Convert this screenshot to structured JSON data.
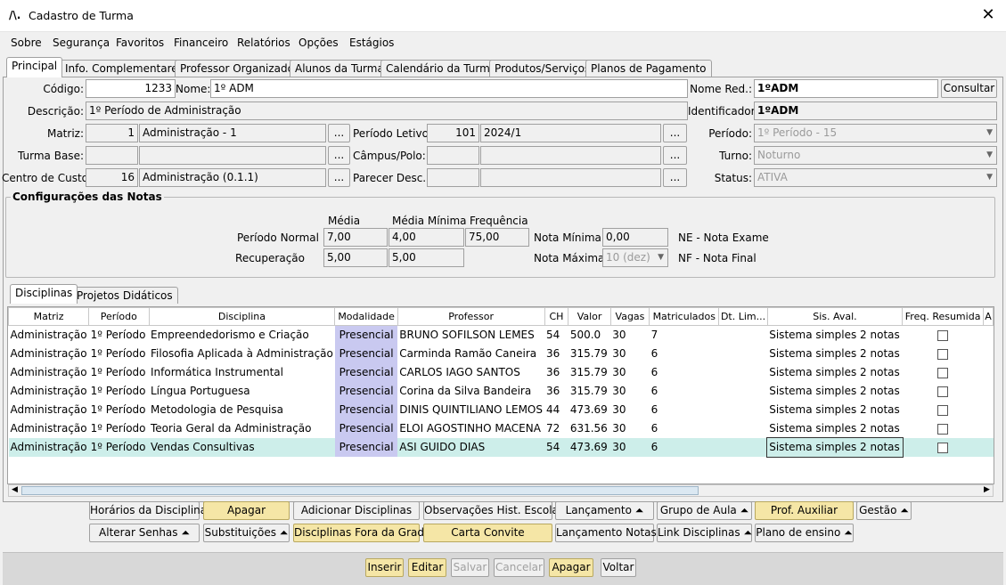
{
  "window": {
    "title": "Cadastro de Turma"
  },
  "menu": [
    "Sobre",
    "Segurança",
    "Favoritos",
    "Financeiro",
    "Relatórios",
    "Opções",
    "Estágios"
  ],
  "tabs": [
    "Principal",
    "Info. Complementares",
    "Professor Organizador",
    "Alunos da Turma",
    "Calendário da Turma",
    "Produtos/Serviços",
    "Planos de Pagamento"
  ],
  "form": {
    "codigo_label": "Código:",
    "codigo": "1233",
    "nome_label": "Nome:",
    "nome": "1º ADM",
    "nome_red_label": "Nome Red.:",
    "nome_red": "1ºADM",
    "consultar": "Consultar",
    "descricao_label": "Descrição:",
    "descricao": "1º Período de Administração",
    "identificador_label": "Identificador:",
    "identificador": "1ºADM",
    "matriz_label": "Matriz:",
    "matriz_cod": "1",
    "matriz": "Administração - 1",
    "periodo_letivo_label": "Período Letivo:",
    "periodo_letivo_cod": "101",
    "periodo_letivo": "2024/1",
    "periodo_label": "Período:",
    "periodo": "1º Período - 15",
    "turma_base_label": "Turma Base:",
    "campus_label": "Câmpus/Polo:",
    "turno_label": "Turno:",
    "turno": "Noturno",
    "centro_custo_label": "Centro de Custo:",
    "centro_custo_cod": "16",
    "centro_custo": "Administração (0.1.1)",
    "parecer_label": "Parecer Desc.:",
    "status_label": "Status:",
    "status": "ATIVA",
    "ellipsis": "..."
  },
  "notas": {
    "title": "Configurações das Notas",
    "h_media": "Média",
    "h_media_min": "Média Mínima",
    "h_freq": "Frequência",
    "periodo_normal": "Período Normal",
    "pn_media": "7,00",
    "pn_media_min": "4,00",
    "pn_freq": "75,00",
    "recuperacao": "Recuperação",
    "rec_media": "5,00",
    "rec_media_min": "5,00",
    "nota_minima_label": "Nota Mínima",
    "nota_minima": "0,00",
    "nota_maxima_label": "Nota Máxima",
    "nota_maxima": "10 (dez)",
    "ne": "NE - Nota Exame",
    "nf": "NF - Nota Final"
  },
  "subtabs": [
    "Disciplinas",
    "Projetos Didáticos"
  ],
  "grid": {
    "columns": [
      "Matriz",
      "Período",
      "Disciplina",
      "Modalidade",
      "Professor",
      "CH",
      "Valor",
      "Vagas",
      "Matriculados",
      "Dt. Lim...",
      "Sis. Aval.",
      "Freq. Resumida",
      "A"
    ],
    "rows": [
      [
        "Administração",
        "1º Período",
        "Empreendedorismo e Criação",
        "Presencial",
        "BRUNO SOFILSON LEMES",
        "54",
        "500.0",
        "30",
        "7",
        "",
        "Sistema simples 2 notas"
      ],
      [
        "Administração",
        "1º Período",
        "Filosofia Aplicada à Administração",
        "Presencial",
        "Carminda Ramão Caneira",
        "36",
        "315.79",
        "30",
        "6",
        "",
        "Sistema simples 2 notas"
      ],
      [
        "Administração",
        "1º Período",
        "Informática Instrumental",
        "Presencial",
        "CARLOS IAGO SANTOS",
        "36",
        "315.79",
        "30",
        "6",
        "",
        "Sistema simples 2 notas"
      ],
      [
        "Administração",
        "1º Período",
        "Língua Portuguesa",
        "Presencial",
        "Corina da Silva Bandeira",
        "36",
        "315.79",
        "30",
        "6",
        "",
        "Sistema simples 2 notas"
      ],
      [
        "Administração",
        "1º Período",
        "Metodologia de Pesquisa",
        "Presencial",
        "DINIS QUINTILIANO LEMOS",
        "44",
        "473.69",
        "30",
        "6",
        "",
        "Sistema simples 2 notas"
      ],
      [
        "Administração",
        "1º Período",
        "Teoria Geral da Administração",
        "Presencial",
        "ELOI AGOSTINHO MACENA",
        "72",
        "631.56",
        "30",
        "6",
        "",
        "Sistema simples 2 notas"
      ],
      [
        "Administração",
        "1º Período",
        "Vendas Consultivas",
        "Presencial",
        "ASI GUIDO DIAS",
        "54",
        "473.69",
        "30",
        "6",
        "",
        "Sistema simples 2 notas"
      ]
    ]
  },
  "actions_row1": [
    "Horários da Disciplina",
    "Apagar",
    "Adicionar Disciplinas",
    "Observações Hist. Escolar",
    "Lançamento ⏶",
    "Grupo de Aula ⏶",
    "Prof. Auxiliar",
    "Gestão ⏶"
  ],
  "actions_row2": [
    "Alterar Senhas ⏶",
    "Substituições ⏶",
    "Disciplinas Fora da Grade",
    "Carta Convite",
    "Lançamento Notas",
    "Link Disciplinas ⏶",
    "Plano de ensino ⏶"
  ],
  "footer": [
    "Inserir",
    "Editar",
    "Salvar",
    "Cancelar",
    "Apagar",
    "Voltar"
  ]
}
